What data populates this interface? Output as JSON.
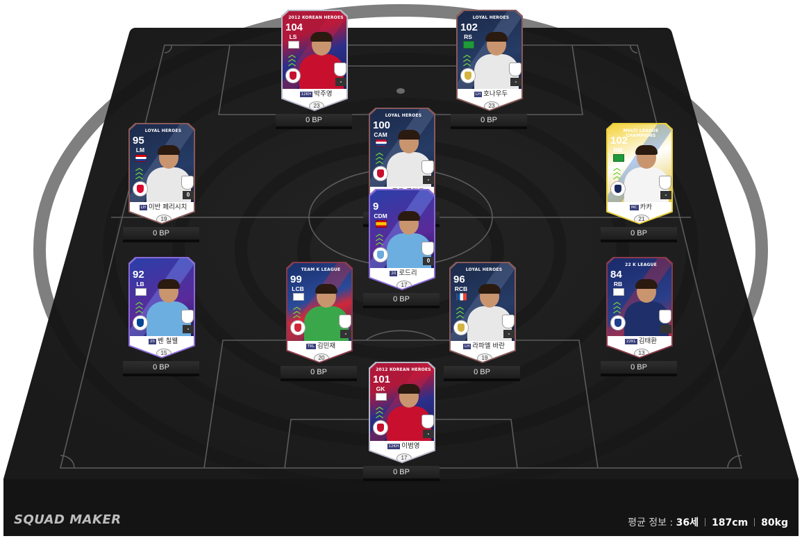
{
  "footer": {
    "brand": "SQUAD MAKER",
    "avg_label": "평균 정보 : ",
    "age": "36세",
    "height": "187cm",
    "weight": "80kg"
  },
  "players": [
    {
      "id": "ls",
      "ovr": "104",
      "pos": "LS",
      "top_label": "2012 KOREAN HEROES",
      "season": "12KH",
      "name": "박주영",
      "salary": "23",
      "bp": "0 BP",
      "level": "-",
      "theme": "kh",
      "flag": "kr",
      "club": "kr"
    },
    {
      "id": "rs",
      "ovr": "102",
      "pos": "RS",
      "top_label": "LOYAL HEROES",
      "season": "LH",
      "name": "호나우두",
      "salary": "23",
      "bp": "0 BP",
      "level": "-",
      "theme": "lh",
      "flag": "br",
      "club": "rm"
    },
    {
      "id": "lm",
      "ovr": "95",
      "pos": "LM",
      "top_label": "LOYAL HEROES",
      "season": "LH",
      "name": "이반 페리시치",
      "salary": "19",
      "bp": "0 BP",
      "level": "0",
      "theme": "lh",
      "flag": "hr",
      "club": "bay"
    },
    {
      "id": "cam",
      "ovr": "100",
      "pos": "CAM",
      "top_label": "LOYAL HEROES",
      "season": "LH",
      "name": "루드 굴리트",
      "salary": "22",
      "bp": "0 BP",
      "level": "-",
      "theme": "lh",
      "flag": "nl",
      "club": "acm"
    },
    {
      "id": "rm",
      "ovr": "102",
      "pos": "RM",
      "top_label": "MULTI LEAGUE CHAMPIONS",
      "season": "MC",
      "name": "카카",
      "salary": "21",
      "bp": "0 BP",
      "level": "-",
      "theme": "mc",
      "flag": "br",
      "club": "mc"
    },
    {
      "id": "cdm",
      "ovr": "9",
      "pos": "CDM",
      "top_label": "",
      "season": "20",
      "name": "로드리",
      "salary": "17",
      "bp": "0 BP",
      "level": "0",
      "theme": "t20",
      "flag": "es",
      "club": "mci"
    },
    {
      "id": "lb",
      "ovr": "92",
      "pos": "LB",
      "top_label": "",
      "season": "20",
      "name": "벤 칠웰",
      "salary": "15",
      "bp": "0 BP",
      "level": "-",
      "theme": "t20",
      "flag": "en",
      "club": "che"
    },
    {
      "id": "lcb",
      "ovr": "99",
      "pos": "LCB",
      "top_label": "TEAM K LEAGUE",
      "season": "TKL",
      "name": "김민재",
      "salary": "20",
      "bp": "0 BP",
      "level": "-",
      "theme": "tkl",
      "flag": "kr",
      "club": "tkl"
    },
    {
      "id": "rcb",
      "ovr": "96",
      "pos": "RCB",
      "top_label": "LOYAL HEROES",
      "season": "LH",
      "name": "라파엘 바란",
      "salary": "19",
      "bp": "0 BP",
      "level": "-",
      "theme": "lh",
      "flag": "fr",
      "club": "rm"
    },
    {
      "id": "rb",
      "ovr": "84",
      "pos": "RB",
      "top_label": "22 K LEAGUE",
      "season": "22KL",
      "name": "김태환",
      "salary": "13",
      "bp": "0 BP",
      "level": "",
      "theme": "kl22",
      "flag": "kr",
      "club": "ulsan"
    },
    {
      "id": "gk",
      "ovr": "101",
      "pos": "GK",
      "top_label": "2012 KOREAN HEROES",
      "season": "12KH",
      "name": "이범영",
      "salary": "17",
      "bp": "0 BP",
      "level": "-",
      "theme": "kh",
      "flag": "kr",
      "club": "kr"
    }
  ],
  "colors": {
    "pitch": "#1e1e1e",
    "pitch_line": "#6a6a6a",
    "chevron": "#71d33a",
    "bp_bar": "#2a2a2a"
  }
}
